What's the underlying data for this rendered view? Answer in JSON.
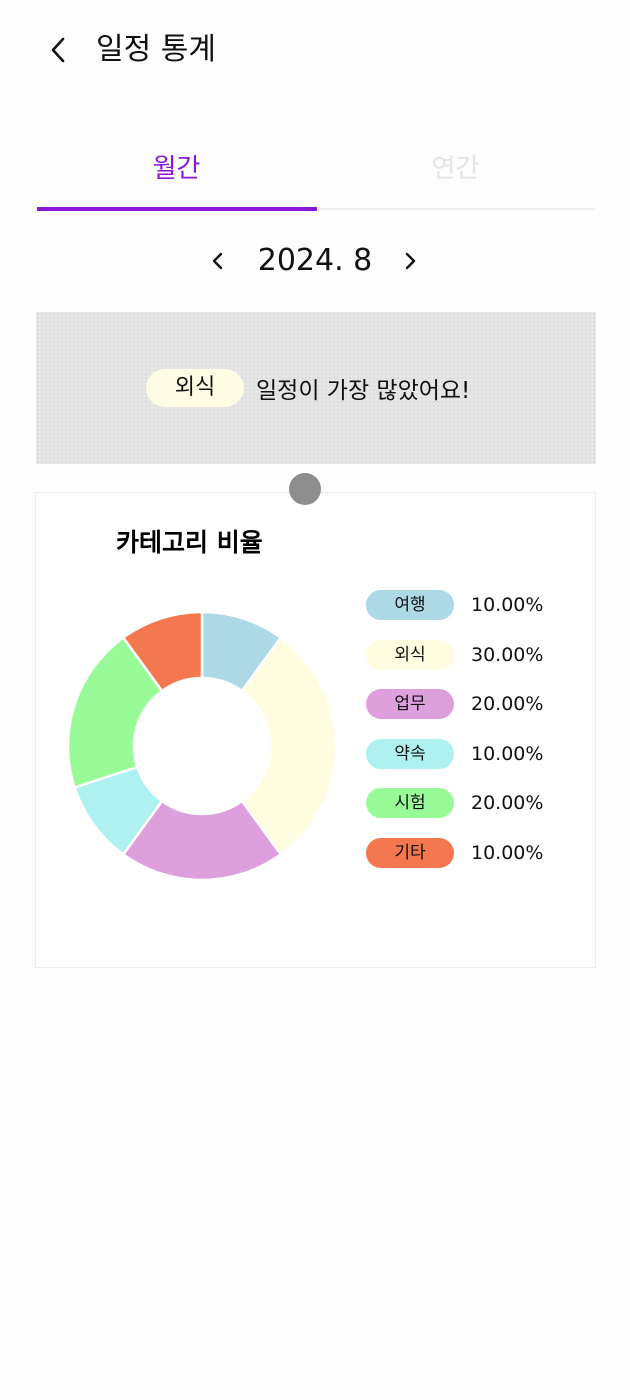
{
  "header": {
    "title": "일정 통계",
    "back_icon": "chevron-left-icon"
  },
  "tabs": [
    {
      "label": "월간",
      "active": true,
      "color": "#8a16d8"
    },
    {
      "label": "연간",
      "active": false,
      "color": "#e3e3e8"
    }
  ],
  "month_nav": {
    "prev_label": "<",
    "next_label": ">",
    "current": "2024. 8"
  },
  "summary": {
    "category": "외식",
    "text": "일정이 가장 많았어요!",
    "pill_color": "#fefde3"
  },
  "card": {
    "title": "카테고리 비율"
  },
  "chart_data": {
    "type": "pie",
    "donut": true,
    "title": "카테고리 비율",
    "categories": [
      "여행",
      "외식",
      "업무",
      "약속",
      "시험",
      "기타"
    ],
    "values": [
      10,
      30,
      20,
      10,
      20,
      10
    ],
    "labels": [
      "10.00%",
      "30.00%",
      "20.00%",
      "10.00%",
      "20.00%",
      "10.00%"
    ],
    "colors": [
      "#add8e6",
      "#fffde0",
      "#dda0dd",
      "#aff0f0",
      "#98fb98",
      "#f4784f"
    ],
    "legend": "right"
  }
}
